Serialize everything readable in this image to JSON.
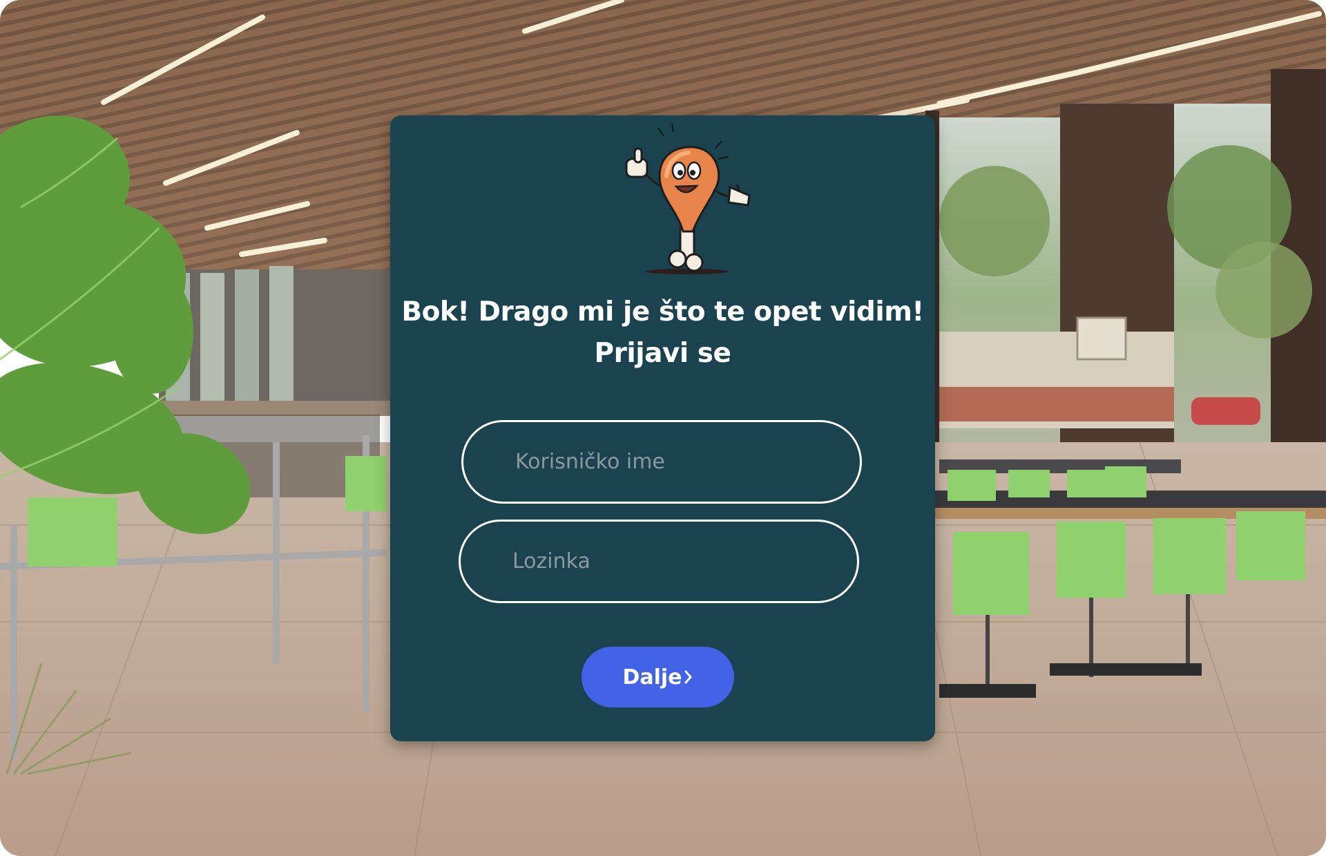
{
  "login": {
    "heading_line1": "Bok! Drago mi je što te opet vidim!",
    "heading_line2": "Prijavi se",
    "username_placeholder": "Korisničko ime",
    "password_placeholder": "Lozinka",
    "next_label": "Dalje"
  },
  "icons": {
    "mascot": "chicken-drumstick-mascot-icon",
    "next": "chevron-right-icon"
  },
  "colors": {
    "card_background": "#1a434f",
    "button_background": "#4263e5",
    "text": "#ffffff",
    "placeholder": "#8b9a9e"
  }
}
